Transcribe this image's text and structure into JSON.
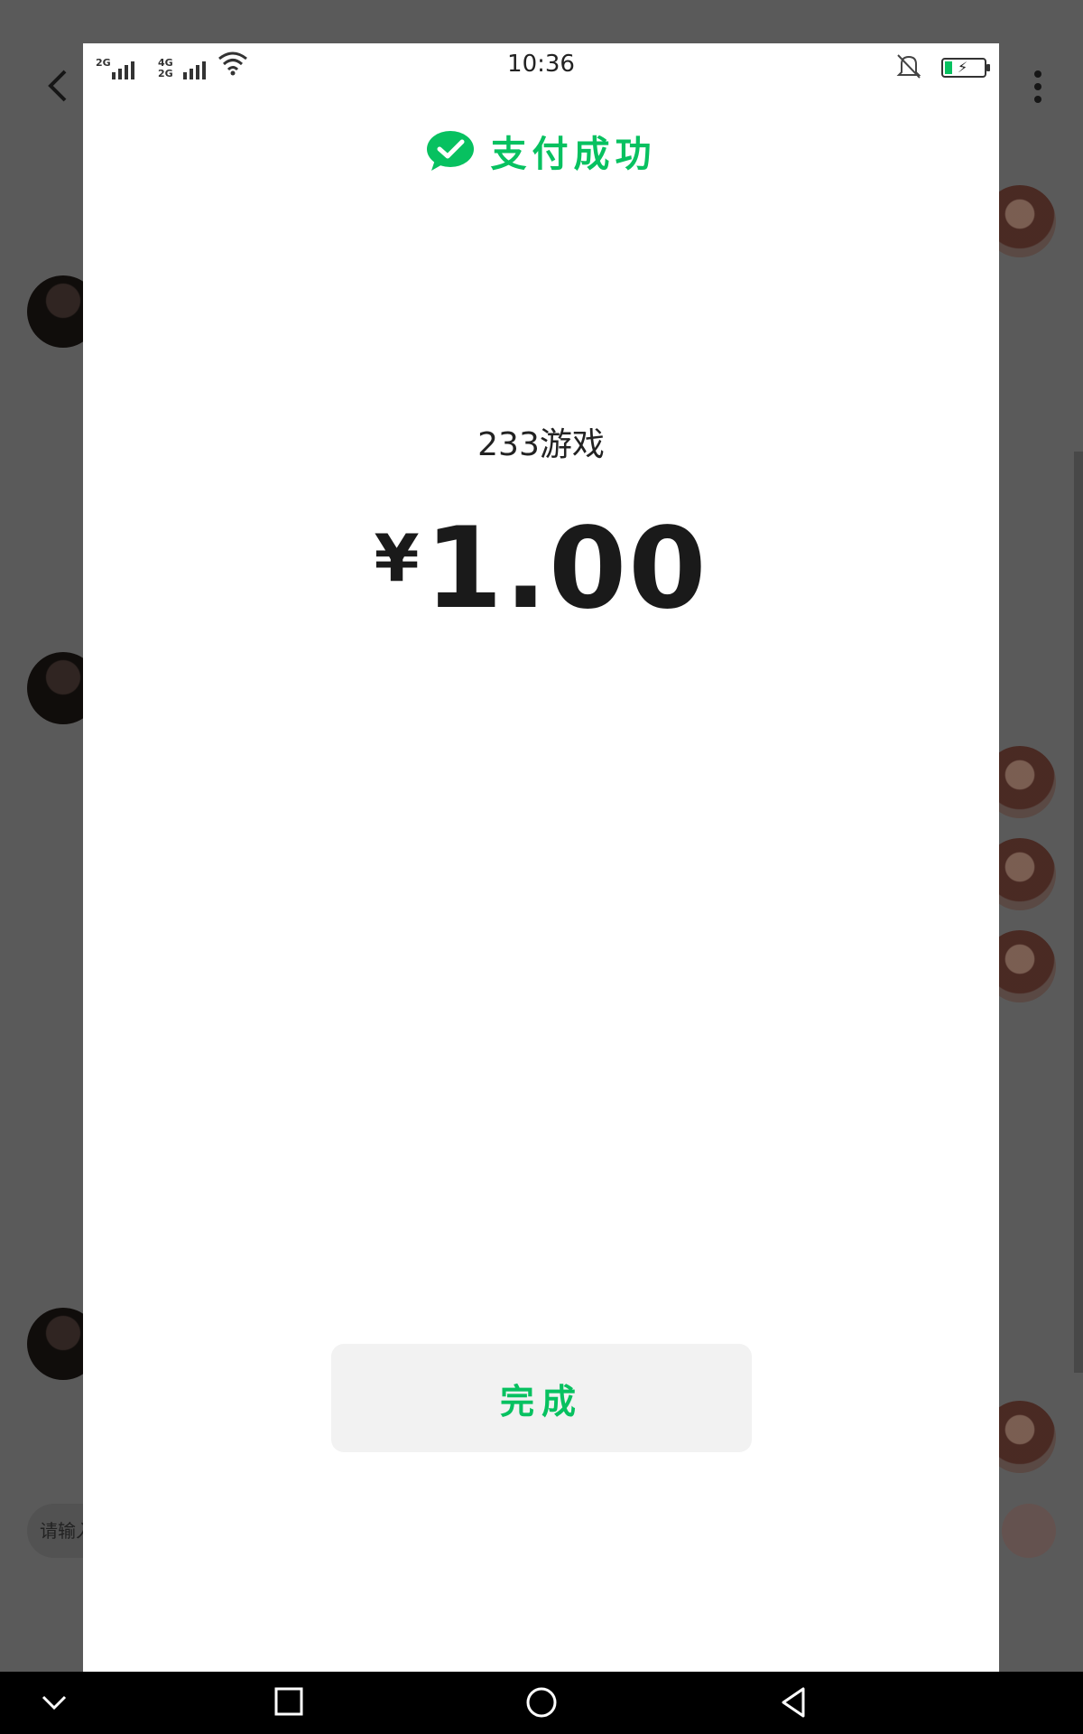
{
  "background_chat": {
    "input_placeholder": "请输入"
  },
  "status_bar": {
    "sim1_label": "2G",
    "sim2_label_top": "4G",
    "sim2_label_bottom": "2G",
    "time": "10:36"
  },
  "payment": {
    "success_text": "支付成功",
    "merchant": "233游戏",
    "currency_symbol": "¥",
    "amount": "1.00",
    "done_label": "完成"
  },
  "colors": {
    "accent": "#07c160",
    "button_bg": "#f2f2f2"
  }
}
